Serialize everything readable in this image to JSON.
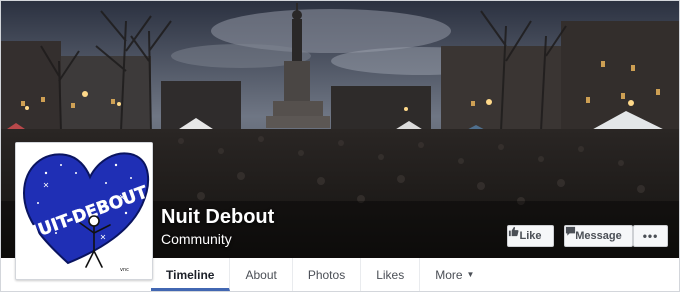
{
  "page": {
    "name": "Nuit Debout",
    "category": "Community"
  },
  "actions": {
    "like_label": "Like",
    "message_label": "Message",
    "more_label": "•••"
  },
  "tabs": [
    {
      "label": "Timeline",
      "active": true
    },
    {
      "label": "About"
    },
    {
      "label": "Photos"
    },
    {
      "label": "Likes"
    },
    {
      "label": "More"
    }
  ],
  "icons": {
    "like": "thumbs-up-icon",
    "message": "chat-bubble-icon",
    "more_caret": "caret-down-icon"
  },
  "colors": {
    "accent": "#4267b2",
    "heart": "#1f2fb5",
    "button_bg": "#f6f7f9"
  },
  "logo_text": "NUIT DEBOUT"
}
